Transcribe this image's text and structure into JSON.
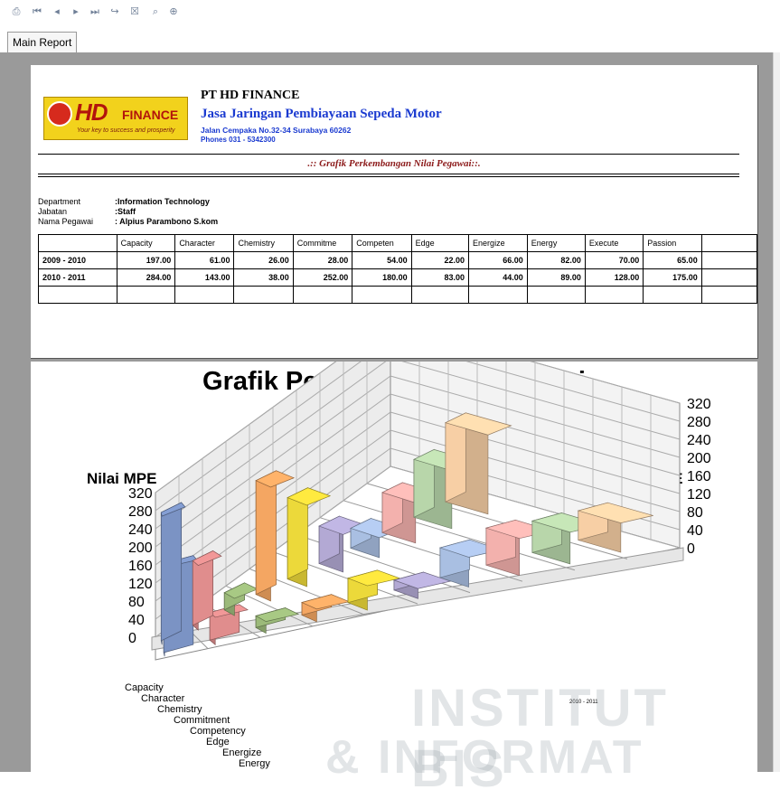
{
  "toolbar": {
    "icons": [
      "print-icon",
      "first-page-icon",
      "previous-page-icon",
      "next-page-icon",
      "last-page-icon",
      "go-to-page-icon",
      "close-report-icon",
      "search-icon",
      "zoom-icon"
    ]
  },
  "tabs": [
    {
      "label": "Main Report"
    }
  ],
  "report": {
    "company_name": "PT HD FINANCE",
    "company_tagline": "Jasa Jaringan Pembiayaan Sepeda Motor",
    "address": "Jalan Cempaka No.32-34 Surabaya 60262",
    "phone": "Phones 031 - 5342300",
    "logo": {
      "brand": "HD",
      "word": "FINANCE",
      "slogan": "Your key to success and prosperity"
    },
    "title": ".:: Grafik Perkembangan Nilai Pegawai::.",
    "info": [
      {
        "label": "Department",
        "value": ":Information Technology"
      },
      {
        "label": "Jabatan",
        "value": ":Staff"
      },
      {
        "label": "Nama Pegawai",
        "value": ": Alpius Parambono S.kom"
      }
    ],
    "table": {
      "headers": [
        "Capacity",
        "Character",
        "Chemistry",
        "Commitme",
        "Competen",
        "Edge",
        "Energize",
        "Energy",
        "Execute",
        "Passion"
      ],
      "rows": [
        {
          "period": "2009 - 2010",
          "values": [
            "197.00",
            "61.00",
            "26.00",
            "28.00",
            "54.00",
            "22.00",
            "66.00",
            "82.00",
            "70.00",
            "65.00"
          ]
        },
        {
          "period": "2010 - 2011",
          "values": [
            "284.00",
            "143.00",
            "38.00",
            "252.00",
            "180.00",
            "83.00",
            "44.00",
            "89.00",
            "128.00",
            "175.00"
          ]
        }
      ]
    }
  },
  "chart_data": {
    "type": "bar",
    "title": "Grafik Perkembangan Pegawai",
    "ylabel": "Nilai MPE",
    "ylim": [
      0,
      320
    ],
    "yticks": [
      "0",
      "40",
      "80",
      "120",
      "160",
      "200",
      "240",
      "280",
      "320"
    ],
    "categories": [
      "Capacity",
      "Character",
      "Chemistry",
      "Commitment",
      "Competency",
      "Edge",
      "Energize",
      "Energy"
    ],
    "series": [
      {
        "name": "2009 - 2010",
        "values": [
          197,
          61,
          26,
          28,
          54,
          22,
          66,
          82,
          70,
          65
        ]
      },
      {
        "name": "2010 - 2011",
        "values": [
          284,
          143,
          38,
          252,
          180,
          83,
          44,
          89,
          128,
          175
        ]
      }
    ],
    "colors": [
      "#7b93c4",
      "#e08d8d",
      "#9cba7a",
      "#f4a662",
      "#ecd93a",
      "#b3a9d4",
      "#a9bfe2",
      "#f3b1ad",
      "#b8d6aa",
      "#f7cfa5"
    ],
    "grid": true
  },
  "watermark": {
    "line1": "INSTITUT BIS",
    "line2": "& INFORMAT"
  }
}
